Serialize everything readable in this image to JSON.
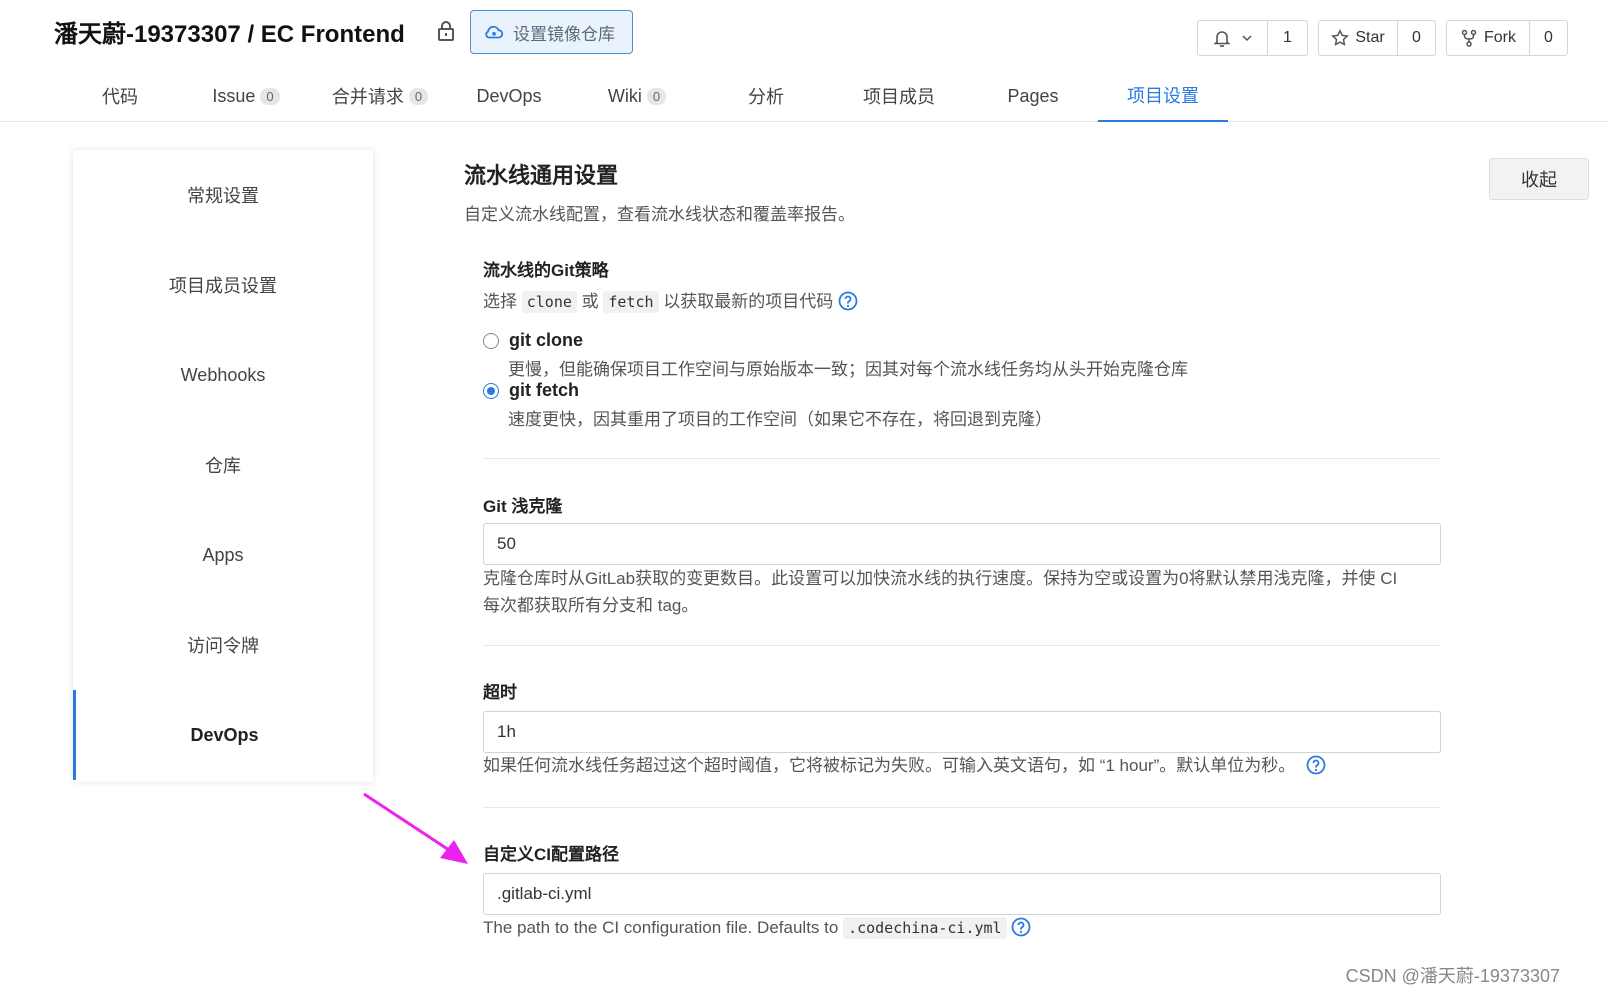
{
  "header": {
    "repo_title": "潘天蔚-19373307 / EC Frontend",
    "mirror_button": "设置镜像仓库",
    "watch_count": "1",
    "star_label": "Star",
    "star_count": "0",
    "fork_label": "Fork",
    "fork_count": "0"
  },
  "tabs": [
    {
      "label": "代码",
      "count": ""
    },
    {
      "label": "Issue",
      "count": "0"
    },
    {
      "label": "合并请求",
      "count": "0"
    },
    {
      "label": "DevOps",
      "count": ""
    },
    {
      "label": "Wiki",
      "count": "0"
    },
    {
      "label": "分析",
      "count": ""
    },
    {
      "label": "项目成员",
      "count": ""
    },
    {
      "label": "Pages",
      "count": ""
    },
    {
      "label": "项目设置",
      "count": ""
    }
  ],
  "sidebar": {
    "items": [
      {
        "label": "常规设置"
      },
      {
        "label": "项目成员设置"
      },
      {
        "label": "Webhooks"
      },
      {
        "label": "仓库"
      },
      {
        "label": "Apps"
      },
      {
        "label": "访问令牌"
      },
      {
        "label": "DevOps"
      }
    ]
  },
  "main": {
    "title": "流水线通用设置",
    "description": "自定义流水线配置，查看流水线状态和覆盖率报告。",
    "collapse_button": "收起",
    "git_strategy": {
      "label": "流水线的Git策略",
      "help_prefix": "选择",
      "code_clone": "clone",
      "help_or": "或",
      "code_fetch": "fetch",
      "help_suffix": "以获取最新的项目代码",
      "options": [
        {
          "label": "git clone",
          "desc": "更慢，但能确保项目工作空间与原始版本一致；因其对每个流水线任务均从头开始克隆仓库",
          "selected": false
        },
        {
          "label": "git fetch",
          "desc": "速度更快，因其重用了项目的工作空间（如果它不存在，将回退到克隆）",
          "selected": true
        }
      ]
    },
    "shallow_clone": {
      "label": "Git 浅克隆",
      "value": "50",
      "help_line1": "克隆仓库时从GitLab获取的变更数目。此设置可以加快流水线的执行速度。保持为空或设置为0将默认禁用浅克隆，并使 CI",
      "help_line2": "每次都获取所有分支和 tag。"
    },
    "timeout": {
      "label": "超时",
      "value": "1h",
      "help": "如果任何流水线任务超过这个超时阈值，它将被标记为失败。可输入英文语句，如 “1 hour”。默认单位为秒。"
    },
    "ci_path": {
      "label": "自定义CI配置路径",
      "value": ".gitlab-ci.yml",
      "help_prefix": "The path to the CI configuration file. Defaults to",
      "help_code": ".codechina-ci.yml"
    }
  },
  "watermark": "CSDN @潘天蔚-19373307",
  "colors": {
    "accent": "#2a7ae2",
    "arrow": "#ee22ee"
  }
}
